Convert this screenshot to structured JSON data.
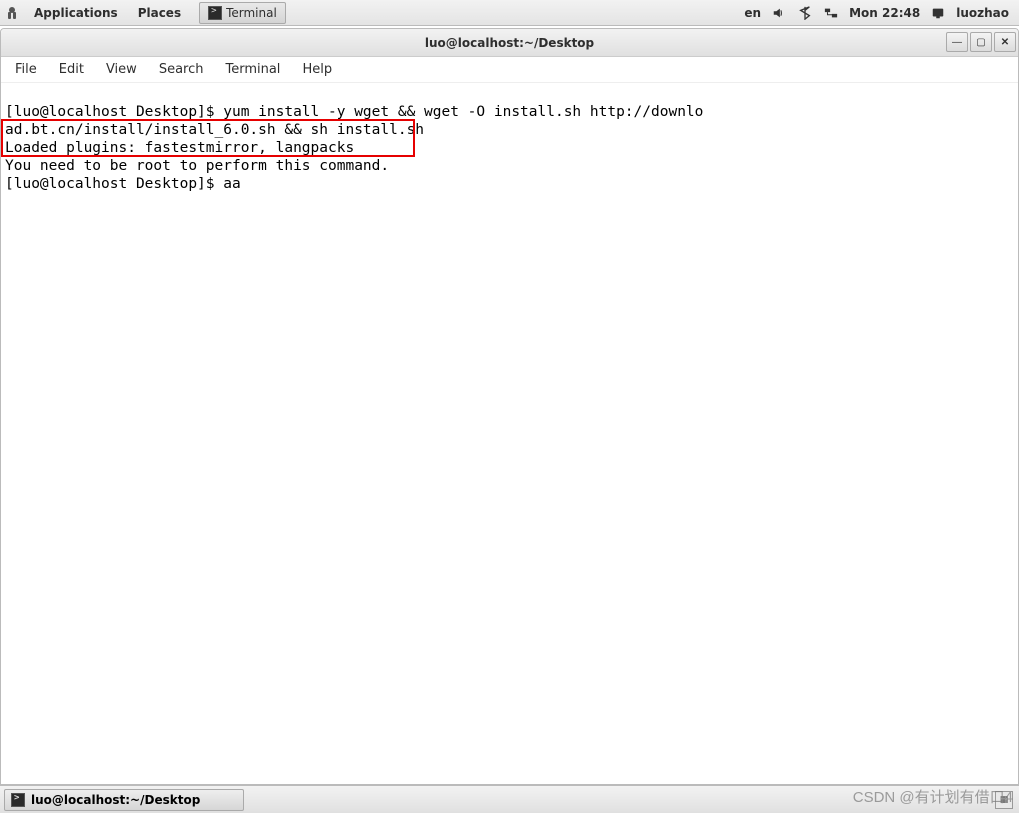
{
  "top_panel": {
    "applications": "Applications",
    "places": "Places",
    "taskbar_app": "Terminal",
    "lang": "en",
    "clock": "Mon 22:48",
    "user": "luozhao"
  },
  "window": {
    "title": "luo@localhost:~/Desktop",
    "menus": {
      "file": "File",
      "edit": "Edit",
      "view": "View",
      "search": "Search",
      "terminal": "Terminal",
      "help": "Help"
    }
  },
  "terminal": {
    "line1": "[luo@localhost Desktop]$ yum install -y wget && wget -O install.sh http://downlo",
    "line2": "ad.bt.cn/install/install_6.0.sh && sh install.sh",
    "boxed1": "Loaded plugins: fastestmirror, langpacks",
    "boxed2": "You need to be root to perform this command.",
    "line5": "[luo@localhost Desktop]$ aa"
  },
  "bottom_panel": {
    "task_label": "luo@localhost:~/Desktop"
  },
  "watermark": "CSDN @有计划有借口4"
}
